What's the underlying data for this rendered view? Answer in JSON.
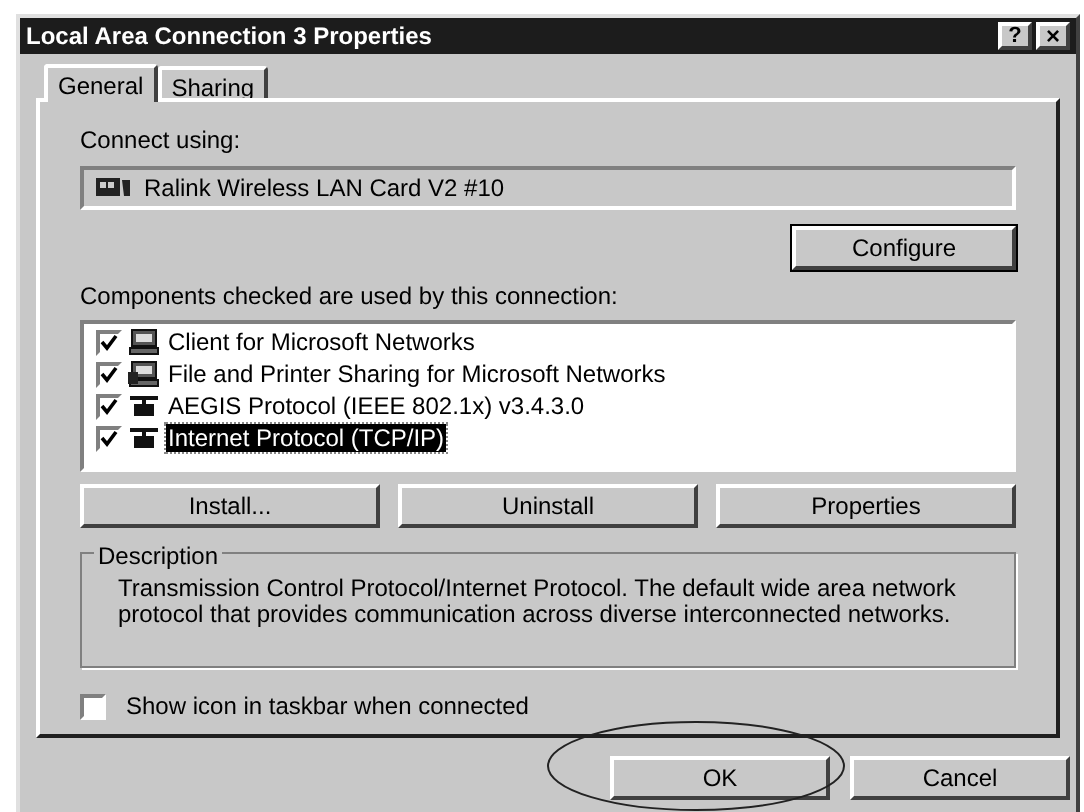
{
  "window": {
    "title": "Local Area Connection 3 Properties",
    "help_button": "?",
    "close_button": "×"
  },
  "tabs": [
    {
      "label": "General",
      "selected": true
    },
    {
      "label": "Sharing",
      "selected": false
    }
  ],
  "connect_using": {
    "label": "Connect using:",
    "adapter": "Ralink Wireless LAN Card V2 #10",
    "configure_button": "Configure"
  },
  "components": {
    "label": "Components checked are used by this connection:",
    "items": [
      {
        "kind": "client",
        "label": "Client for Microsoft Networks",
        "checked": true,
        "selected": false
      },
      {
        "kind": "service",
        "label": "File and Printer Sharing for Microsoft Networks",
        "checked": true,
        "selected": false
      },
      {
        "kind": "protocol",
        "label": "AEGIS Protocol (IEEE 802.1x) v3.4.3.0",
        "checked": true,
        "selected": false
      },
      {
        "kind": "protocol",
        "label": "Internet Protocol (TCP/IP)",
        "checked": true,
        "selected": true
      }
    ],
    "buttons": [
      "Install...",
      "Uninstall",
      "Properties"
    ]
  },
  "description": {
    "legend": "Description",
    "text": "Transmission Control Protocol/Internet Protocol. The default wide area network protocol that provides communication across diverse interconnected networks."
  },
  "show_icon": {
    "label": "Show icon in taskbar when connected",
    "checked": false
  },
  "dialog_buttons": [
    "OK",
    "Cancel"
  ]
}
